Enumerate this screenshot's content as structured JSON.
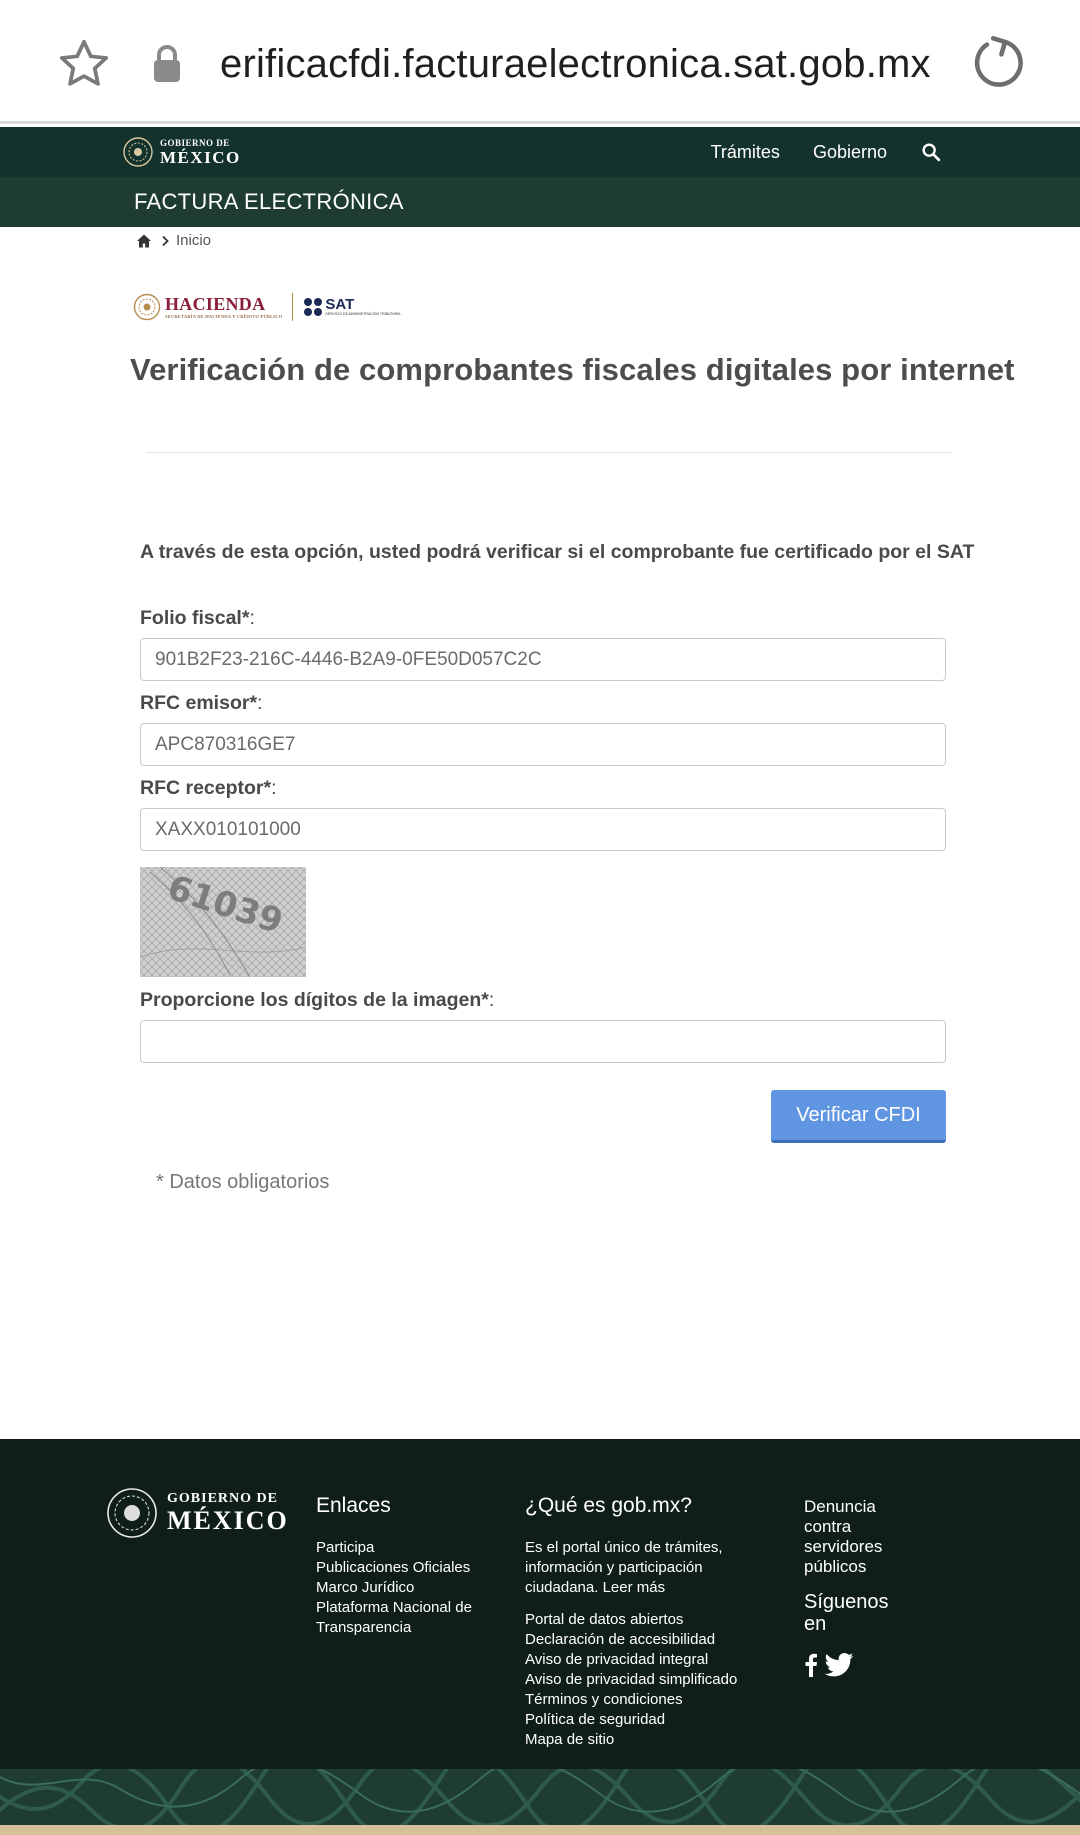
{
  "browser": {
    "url": "erificacfdi.facturaelectronica.sat.gob.mx"
  },
  "gov_header": {
    "logo_small": "GOBIERNO DE",
    "logo_big": "MÉXICO",
    "nav": [
      "Trámites",
      "Gobierno"
    ]
  },
  "section_bar": {
    "title": "FACTURA ELECTRÓNICA"
  },
  "breadcrumb": {
    "current": "Inicio"
  },
  "agency_logos": {
    "hacienda": "HACIENDA",
    "hacienda_sub": "SECRETARÍA DE HACIENDA Y CRÉDITO PÚBLICO",
    "sat": "SAT",
    "sat_sub": "SERVICIO DE ADMINISTRACIÓN TRIBUTARIA"
  },
  "main": {
    "title": "Verificación de comprobantes fiscales digitales por internet",
    "intro": "A través de esta opción, usted podrá verificar si el comprobante fue certificado por el SAT",
    "fields": [
      {
        "label": "Folio fiscal*",
        "value": "901B2F23-216C-4446-B2A9-0FE50D057C2C"
      },
      {
        "label": "RFC emisor*",
        "value": "APC870316GE7"
      },
      {
        "label": "RFC receptor*",
        "value": "XAXX010101000"
      }
    ],
    "captcha_text": "61039",
    "captcha_label": "Proporcione los dígitos de la imagen*",
    "captcha_value": "",
    "colon": ":",
    "verify_button": "Verificar CFDI",
    "required_note": "* Datos obligatorios"
  },
  "footer": {
    "logo_small": "GOBIERNO DE",
    "logo_big": "MÉXICO",
    "enlaces_title": "Enlaces",
    "enlaces": [
      "Participa",
      "Publicaciones Oficiales",
      "Marco Jurídico",
      "Plataforma Nacional de Transparencia"
    ],
    "que_es_title": "¿Qué es gob.mx?",
    "que_es_text": "Es el portal único de trámites, información y participación ciudadana. Leer más",
    "links2": [
      "Portal de datos abiertos",
      "Declaración de accesibilidad",
      "Aviso de privacidad integral",
      "Aviso de privacidad simplificado",
      "Términos y condiciones",
      "Política de seguridad",
      "Mapa de sitio"
    ],
    "denuncia": "Denuncia contra servidores públicos",
    "siguenos": "Síguenos en"
  },
  "colors": {
    "gov_dark": "#13322b",
    "section_bar": "#1f3c34",
    "footer_bg": "#0f1e1b",
    "button_blue": "#6095e1",
    "hacienda_red": "#8a1c38"
  },
  "icons": [
    "star-icon",
    "lock-icon",
    "reload-icon",
    "search-icon",
    "home-icon",
    "chevron-right-icon",
    "facebook-icon",
    "twitter-icon"
  ]
}
